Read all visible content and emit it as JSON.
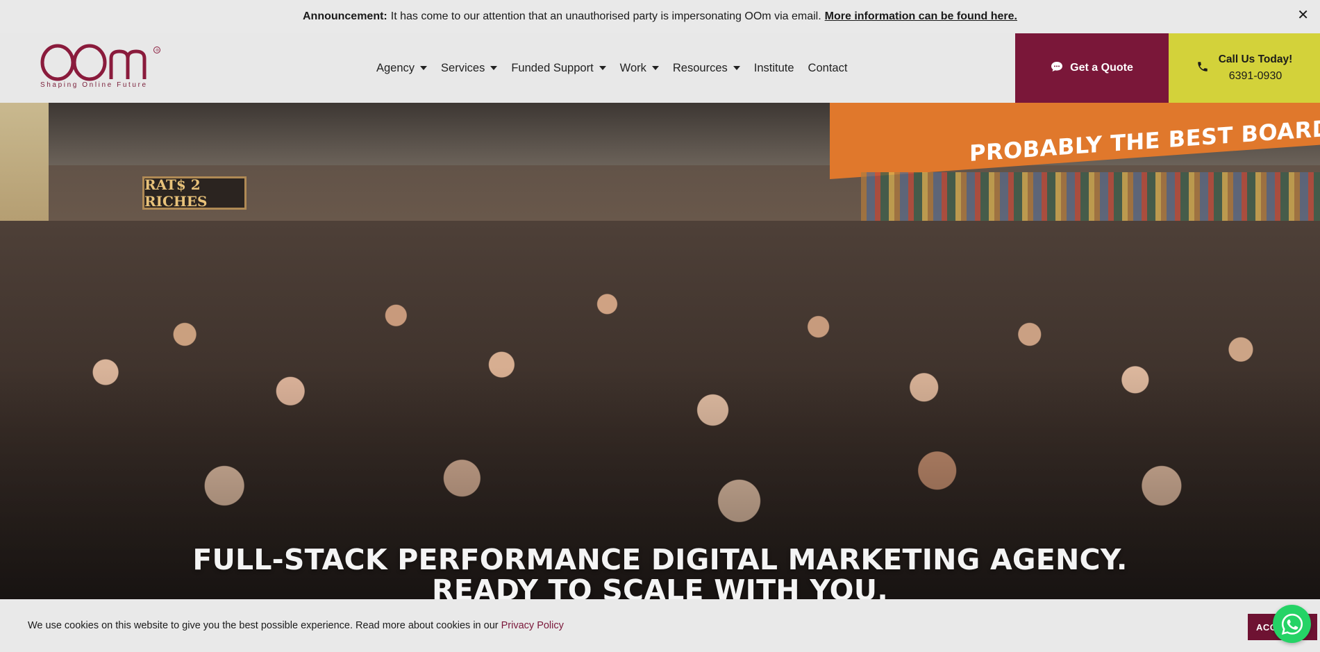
{
  "announcement": {
    "label": "Announcement:",
    "text": "It has come to our attention that an unauthorised party is impersonating OOm via email.",
    "link": "More information can be found here.",
    "close_icon": "close-icon"
  },
  "header": {
    "logo_text": "OOm",
    "logo_registered": "®",
    "tagline": "Shaping Online Future",
    "nav": [
      {
        "label": "Agency",
        "has_dropdown": true
      },
      {
        "label": "Services",
        "has_dropdown": true
      },
      {
        "label": "Funded Support",
        "has_dropdown": true
      },
      {
        "label": "Work",
        "has_dropdown": true
      },
      {
        "label": "Resources",
        "has_dropdown": true
      },
      {
        "label": "Institute",
        "has_dropdown": false
      },
      {
        "label": "Contact",
        "has_dropdown": false
      }
    ],
    "quote_button": {
      "label": "Get a Quote",
      "icon": "chat-icon",
      "color": "#7a1739"
    },
    "call_button": {
      "line1": "Call Us Today!",
      "line2": "6391-0930",
      "icon": "phone-icon",
      "color": "#d3d23a"
    }
  },
  "hero": {
    "wall_sign": "PROBABLY THE BEST BOARDGAME CAFE IN THE W",
    "shop_sign": "RAT$ 2 RICHES",
    "headline_line1": "FULL-STACK PERFORMANCE DIGITAL MARKETING AGENCY.",
    "headline_line2": "READY TO SCALE WITH YOU."
  },
  "cookie_bar": {
    "text": "We use cookies on this website to give you the best possible experience. Read more about cookies in our",
    "link": "Privacy Policy",
    "accept_label": "ACCEPT"
  },
  "whatsapp": {
    "icon": "whatsapp-icon"
  },
  "colors": {
    "brand": "#7a1739",
    "accent": "#d3d23a",
    "whatsapp": "#25d366"
  }
}
